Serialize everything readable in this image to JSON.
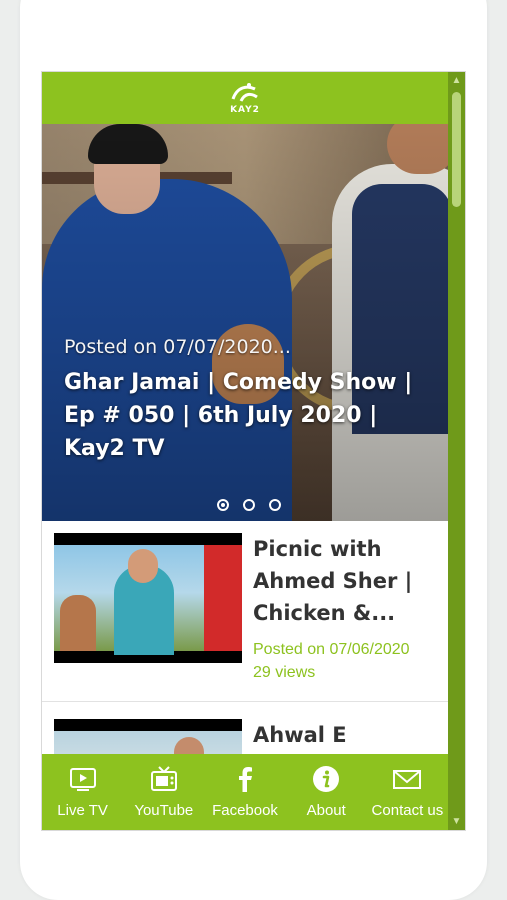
{
  "app": {
    "logo_text": "KAY2"
  },
  "hero": {
    "posted": "Posted on 07/07/2020...",
    "title": "Ghar Jamai | Comedy Show | Ep # 050 | 6th July 2020 | Kay2 TV",
    "carousel_count": 3,
    "carousel_active": 1
  },
  "videos": [
    {
      "title": "Picnic with Ahmed Sher | Chicken &...",
      "posted": "Posted on 07/06/2020",
      "views": "29 views"
    },
    {
      "title": "Ahwal E Lahore"
    }
  ],
  "tabs": [
    {
      "label": "Live TV",
      "icon": "tv-icon"
    },
    {
      "label": "YouTube",
      "icon": "youtube-icon"
    },
    {
      "label": "Facebook",
      "icon": "facebook-icon"
    },
    {
      "label": "About",
      "icon": "info-icon"
    },
    {
      "label": "Contact us",
      "icon": "mail-icon"
    }
  ],
  "colors": {
    "accent": "#8dc21f",
    "scrollbar": "#6f9a1a"
  }
}
